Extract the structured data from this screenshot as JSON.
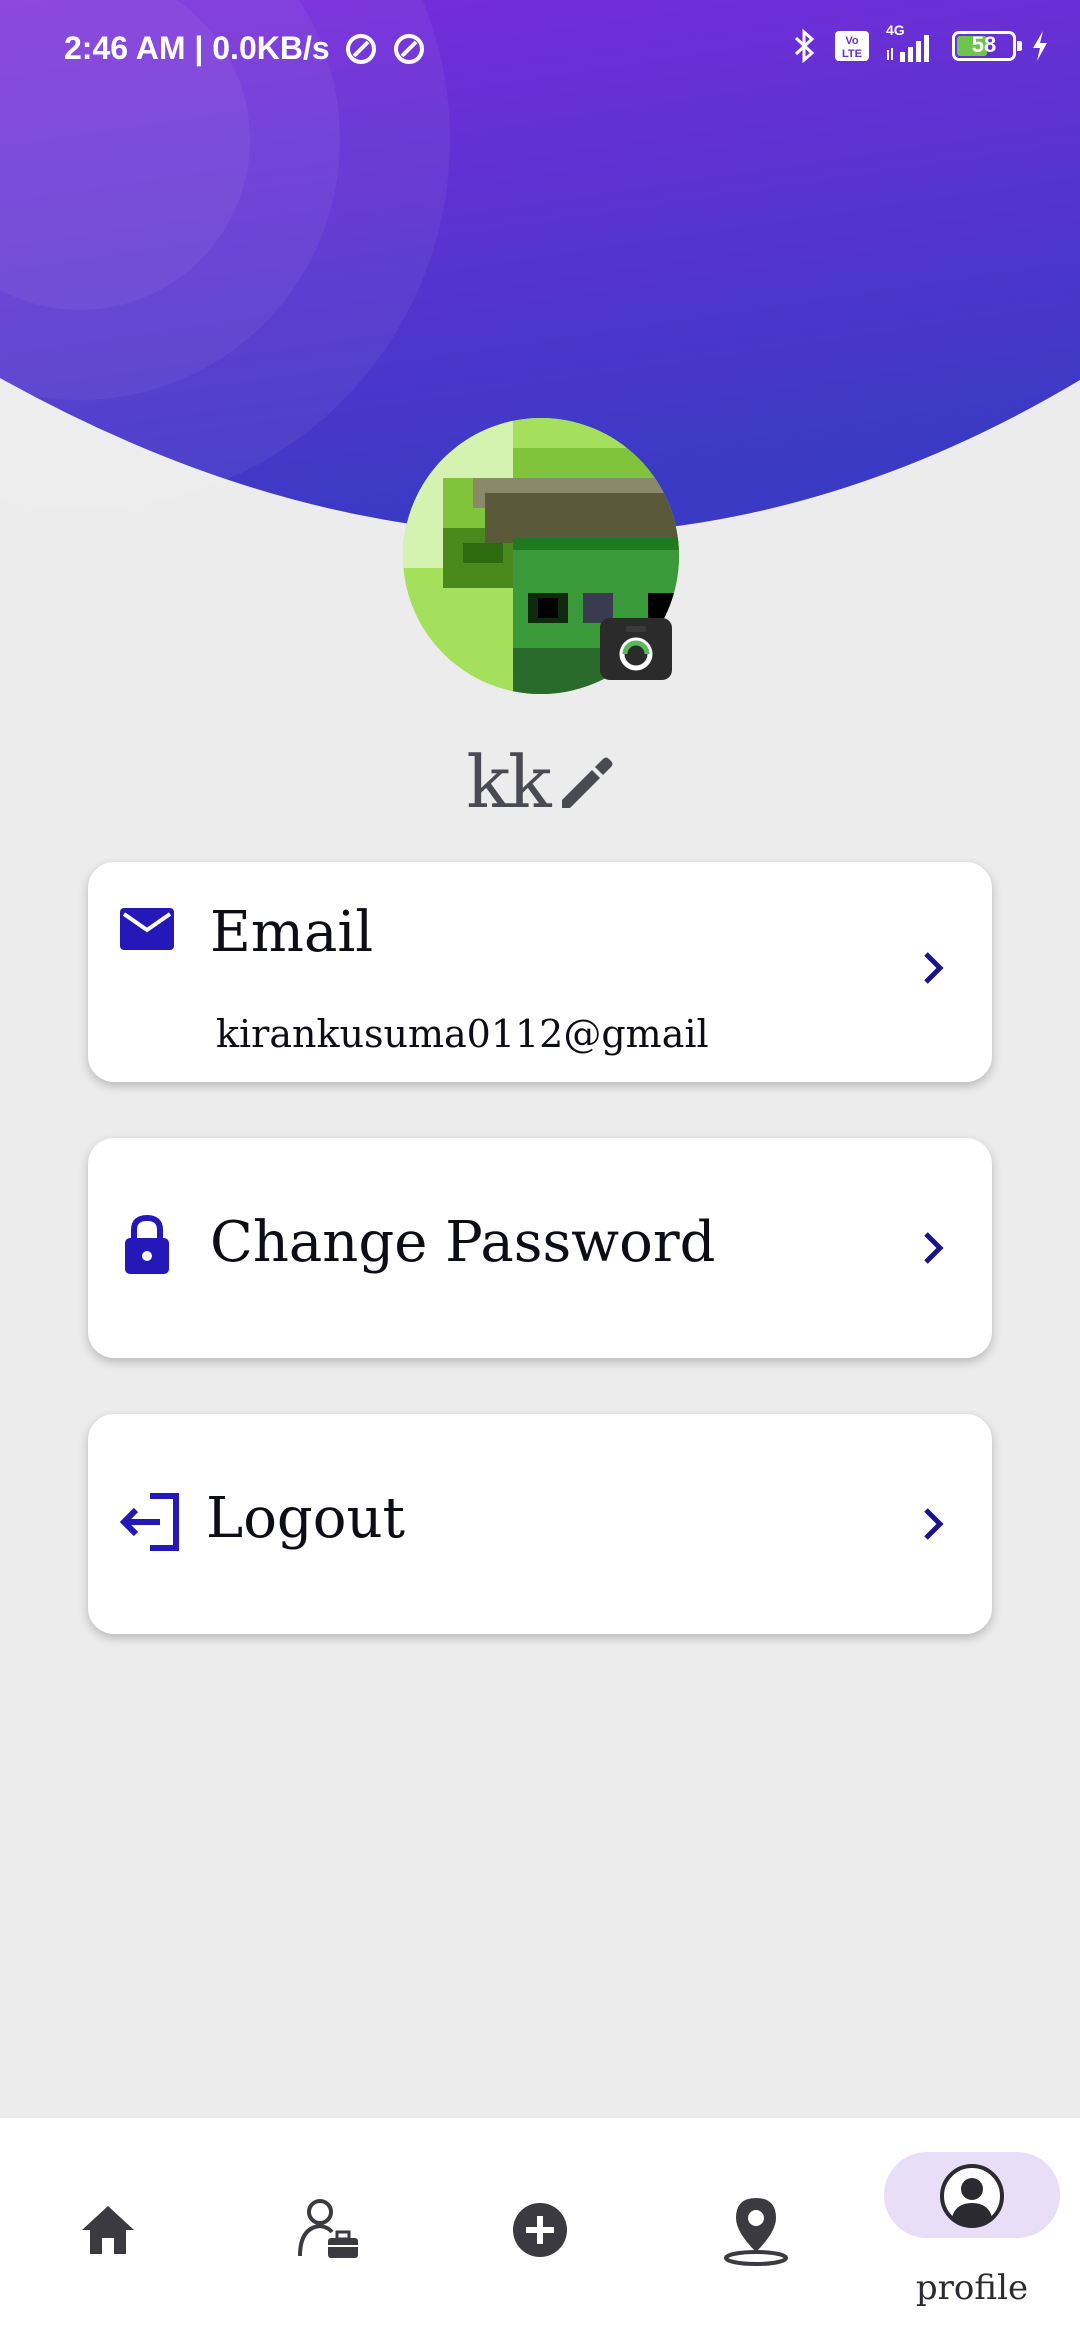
{
  "status_bar": {
    "time_speed": "2:46 AM | 0.0KB/s",
    "battery_percent": "58",
    "battery_level": 58,
    "network": "4G"
  },
  "profile": {
    "username": "kk"
  },
  "cards": {
    "email": {
      "title": "Email",
      "value": "kirankusuma0112@gmail"
    },
    "change_password": {
      "title": "Change Password"
    },
    "logout": {
      "title": "Logout"
    }
  },
  "bottom_nav": {
    "items": [
      "home",
      "jobs",
      "add",
      "location",
      "profile"
    ],
    "active_label": "profile"
  },
  "colors": {
    "accent": "#2419b8",
    "header_top": "#7b2bdc",
    "header_bottom": "#3a3ac4",
    "active_pill": "#e8def8"
  }
}
